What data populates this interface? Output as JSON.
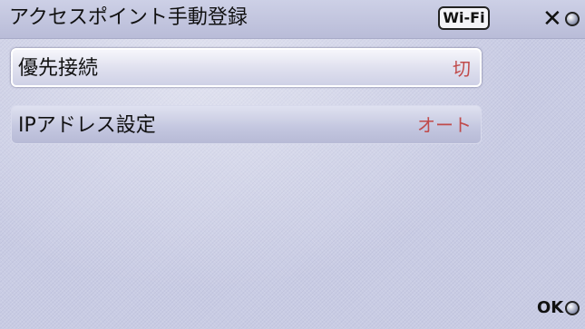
{
  "header": {
    "title": "アクセスポイント手動登録",
    "badge": "Wi-Fi",
    "close_label": "✕"
  },
  "settings": [
    {
      "label": "優先接続",
      "value": "切",
      "selected": true
    },
    {
      "label": "IPアドレス設定",
      "value": "オート",
      "selected": false
    }
  ],
  "footer": {
    "ok_label": "OK"
  },
  "colors": {
    "value_text": "#c04a4a",
    "background": "#c9cce4"
  },
  "icons": {
    "close": "close-icon",
    "knob": "round-button-icon"
  }
}
